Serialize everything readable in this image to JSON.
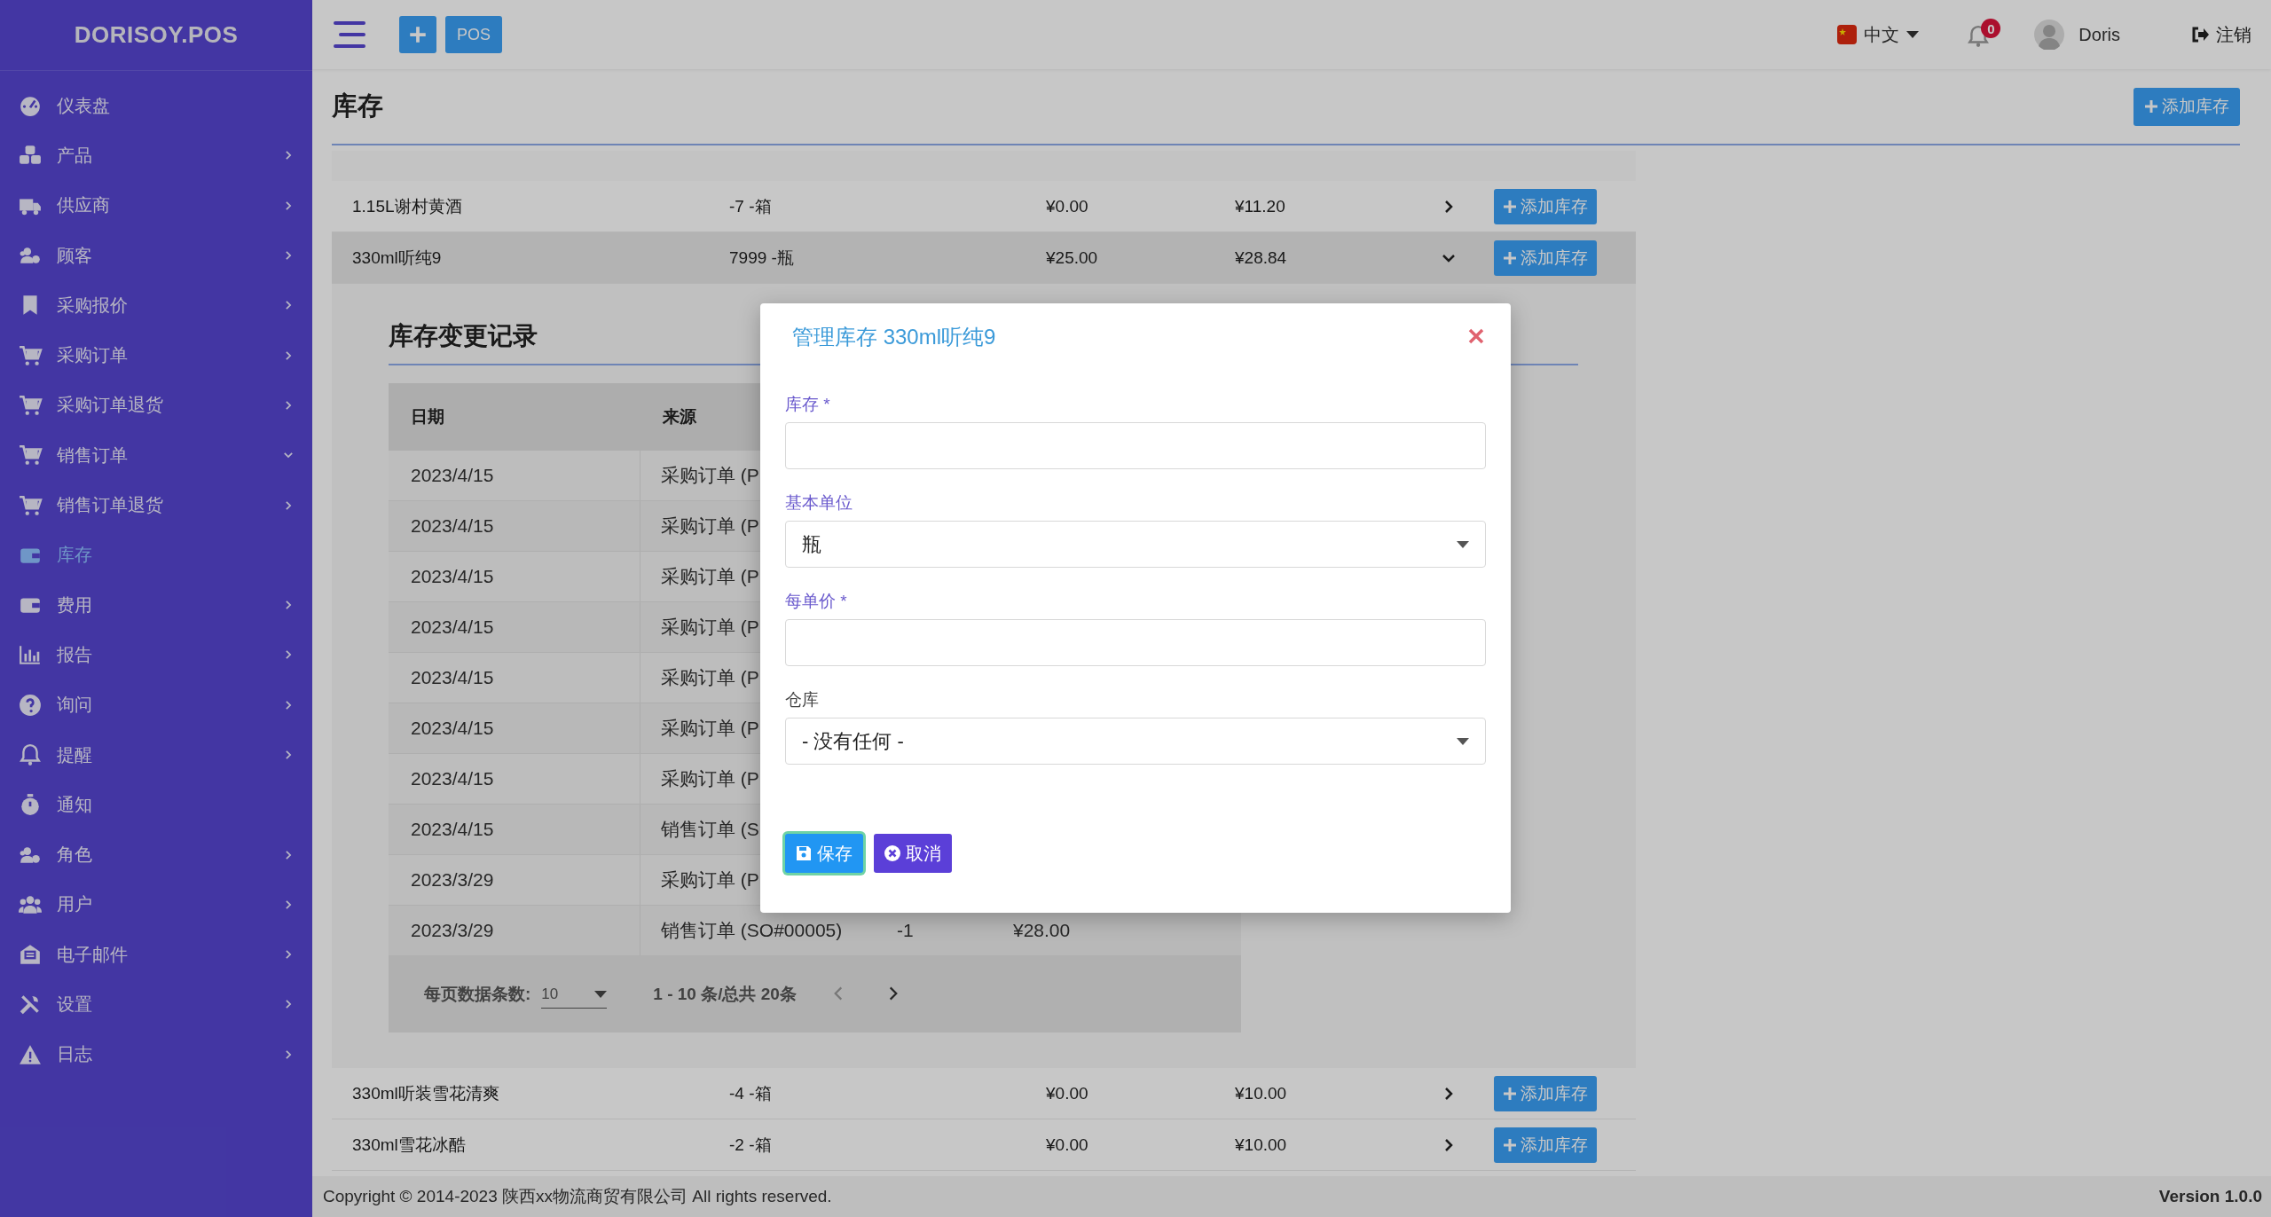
{
  "sidebar": {
    "logo": "DORISOY.POS",
    "items": [
      {
        "label": "仪表盘",
        "submenu": false,
        "selected": false
      },
      {
        "label": "产品",
        "submenu": true,
        "expanded": false,
        "selected": false
      },
      {
        "label": "供应商",
        "submenu": true,
        "expanded": false,
        "selected": false
      },
      {
        "label": "顾客",
        "submenu": true,
        "expanded": false,
        "selected": false
      },
      {
        "label": "采购报价",
        "submenu": true,
        "expanded": false,
        "selected": false
      },
      {
        "label": "采购订单",
        "submenu": true,
        "expanded": false,
        "selected": false
      },
      {
        "label": "采购订单退货",
        "submenu": true,
        "expanded": false,
        "selected": false
      },
      {
        "label": "销售订单",
        "submenu": true,
        "expanded": true,
        "selected": false
      },
      {
        "label": "销售订单退货",
        "submenu": true,
        "expanded": false,
        "selected": false
      },
      {
        "label": "库存",
        "submenu": false,
        "selected": true
      },
      {
        "label": "费用",
        "submenu": true,
        "expanded": false,
        "selected": false
      },
      {
        "label": "报告",
        "submenu": true,
        "expanded": false,
        "selected": false
      },
      {
        "label": "询问",
        "submenu": true,
        "expanded": false,
        "selected": false
      },
      {
        "label": "提醒",
        "submenu": true,
        "expanded": false,
        "selected": false
      },
      {
        "label": "通知",
        "submenu": false,
        "selected": false
      },
      {
        "label": "角色",
        "submenu": true,
        "expanded": false,
        "selected": false
      },
      {
        "label": "用户",
        "submenu": true,
        "expanded": false,
        "selected": false
      },
      {
        "label": "电子邮件",
        "submenu": true,
        "expanded": false,
        "selected": false
      },
      {
        "label": "设置",
        "submenu": true,
        "expanded": false,
        "selected": false
      },
      {
        "label": "日志",
        "submenu": true,
        "expanded": false,
        "selected": false
      }
    ]
  },
  "topbar": {
    "pos_button": "POS",
    "language": "中文",
    "notifications": "0",
    "user": "Doris",
    "logout": "注销"
  },
  "page": {
    "title": "库存",
    "add_button": "添加库存"
  },
  "stock_table": {
    "rows": [
      {
        "name": "1.15L谢村黄酒",
        "quantity": "-7 -箱",
        "column_3": "¥0.00",
        "column_4": "¥11.20",
        "expanded": false,
        "button": "添加库存"
      },
      {
        "name": "330ml听纯9",
        "quantity": "7999 -瓶",
        "column_3": "¥25.00",
        "column_4": "¥28.84",
        "expanded": true,
        "button": "添加库存",
        "history": {
          "title": "库存变更记录",
          "columns": [
            "日期",
            "来源"
          ],
          "rows": [
            {
              "date": "2023/4/15",
              "source": "采购订单 (P"
            },
            {
              "date": "2023/4/15",
              "source": "采购订单 (P"
            },
            {
              "date": "2023/4/15",
              "source": "采购订单 (P"
            },
            {
              "date": "2023/4/15",
              "source": "采购订单 (P"
            },
            {
              "date": "2023/4/15",
              "source": "采购订单 (P"
            },
            {
              "date": "2023/4/15",
              "source": "采购订单 (P"
            },
            {
              "date": "2023/4/15",
              "source": "采购订单 (P"
            },
            {
              "date": "2023/4/15",
              "source": "销售订单 (S"
            },
            {
              "date": "2023/3/29",
              "source": "采购订单 (P"
            },
            {
              "date": "2023/3/29",
              "source": "销售订单 (SO#00005)",
              "column_3": "-1",
              "column_4": "¥28.00"
            }
          ],
          "pagination": {
            "label": "每页数据条数:",
            "page_size": "10",
            "range": "1 - 10 条/总共 20条"
          }
        }
      },
      {
        "name": "330ml听装雪花清爽",
        "quantity": "-4 -箱",
        "column_3": "¥0.00",
        "column_4": "¥10.00",
        "expanded": false,
        "button": "添加库存"
      },
      {
        "name": "330ml雪花冰酷",
        "quantity": "-2 -箱",
        "column_3": "¥0.00",
        "column_4": "¥10.00",
        "expanded": false,
        "button": "添加库存"
      }
    ]
  },
  "modal": {
    "title": "管理库存 330ml听纯9",
    "fields": [
      {
        "label": "库存 *",
        "kind": "input",
        "muted": false
      },
      {
        "label": "基本单位",
        "kind": "select",
        "value": "瓶",
        "muted": false
      },
      {
        "label": "每单价 *",
        "kind": "input",
        "muted": false
      },
      {
        "label": "仓库",
        "kind": "select",
        "value": "- 没有任何 -",
        "muted": true
      }
    ],
    "save_button": "保存",
    "cancel_button": "取消"
  },
  "footer": {
    "copyright": "Copyright © 2014-2023 陕西xx物流商贸有限公司 All rights reserved.",
    "version": "Version 1.0.0"
  }
}
